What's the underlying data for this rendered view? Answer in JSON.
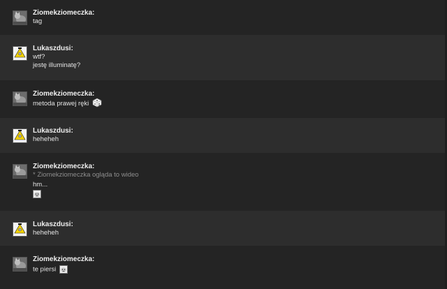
{
  "messages": [
    {
      "author": "Ziomekziomeczka:",
      "avatar": "gray-cat-avatar",
      "lines": [
        "tag"
      ]
    },
    {
      "author": "Lukaszdusi:",
      "avatar": "yellow-triangle-avatar",
      "lines": [
        "wtf?",
        "jestę illuminatę?"
      ]
    },
    {
      "author": "Ziomekziomeczka:",
      "avatar": "gray-cat-avatar",
      "lines": [
        "metoda prawej ręki"
      ],
      "emoticon": "dice-icon"
    },
    {
      "author": "Lukaszdusi:",
      "avatar": "yellow-triangle-avatar",
      "lines": [
        "heheheh"
      ]
    },
    {
      "author": "Ziomekziomeczka:",
      "avatar": "gray-cat-avatar",
      "action": "* Ziomekziomeczka ogląda to wideo",
      "lines": [
        "hm..."
      ],
      "emoticon": "face-icon"
    },
    {
      "author": "Lukaszdusi:",
      "avatar": "yellow-triangle-avatar",
      "lines": [
        "heheheh"
      ]
    },
    {
      "author": "Ziomekziomeczka:",
      "avatar": "gray-cat-avatar",
      "lines": [
        "te piersi"
      ],
      "emoticon": "face-icon"
    }
  ]
}
